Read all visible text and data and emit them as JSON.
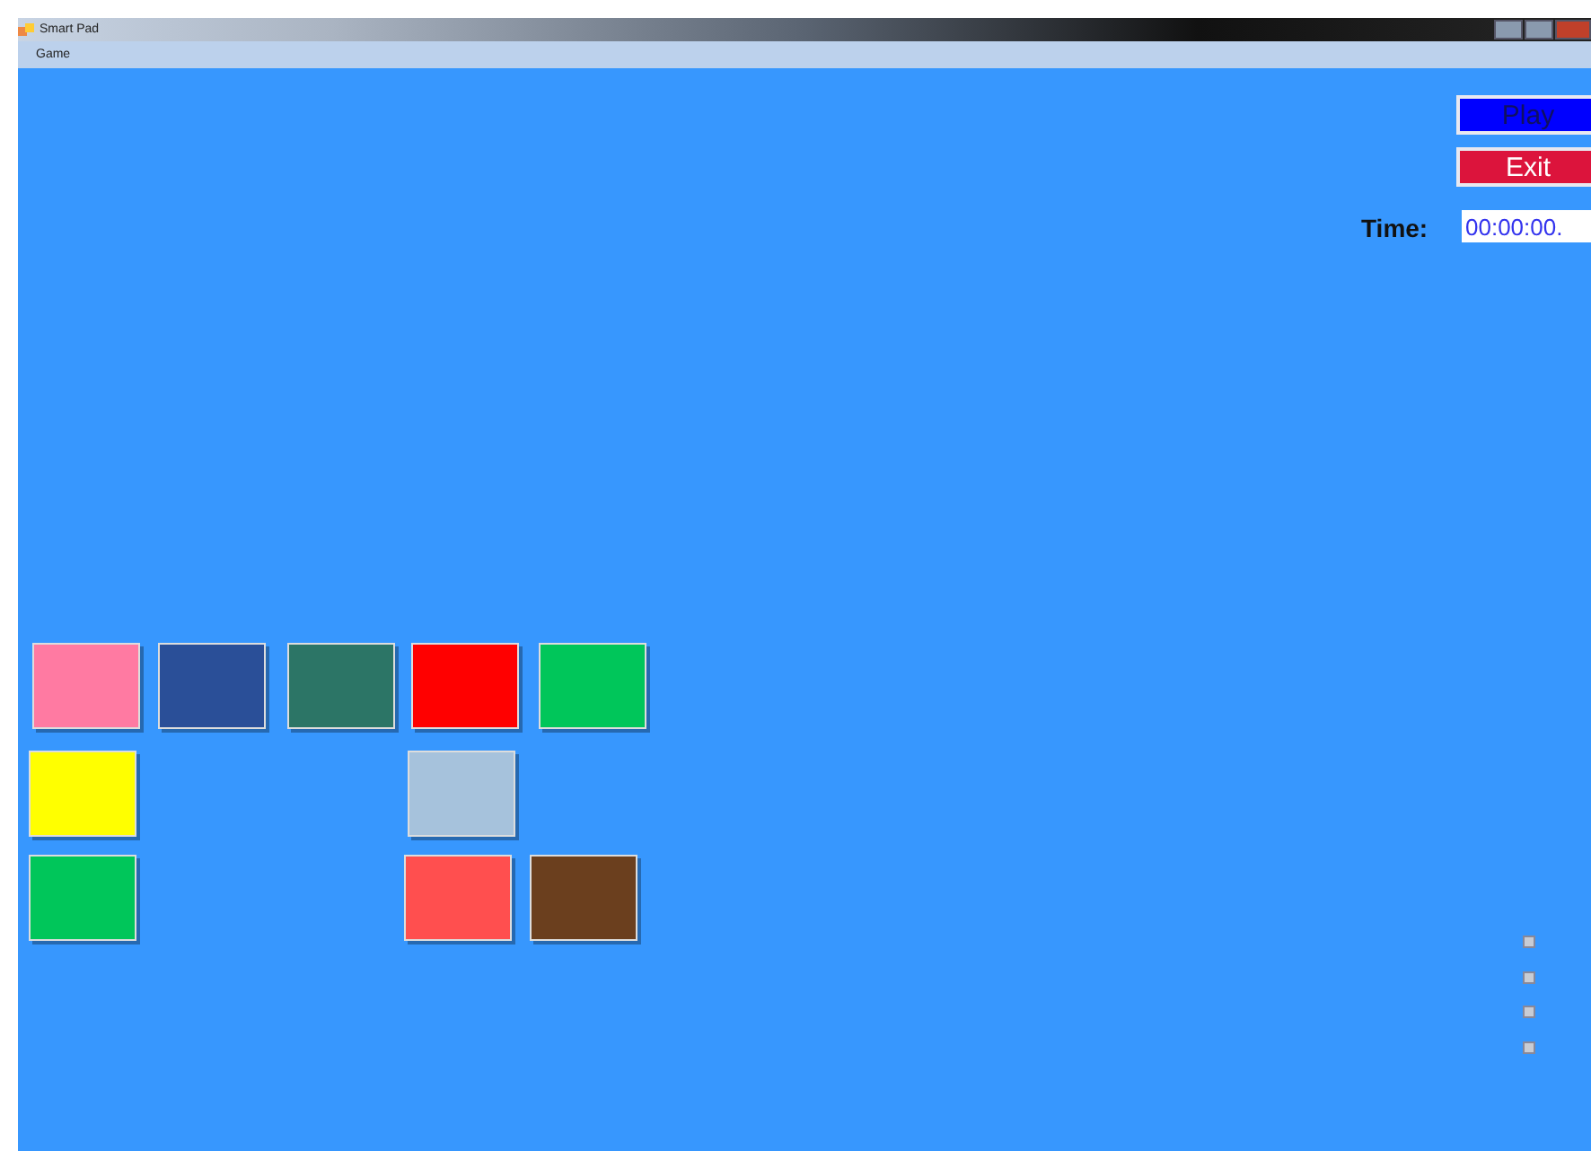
{
  "window": {
    "title": "Smart Pad"
  },
  "menu": [
    "Game"
  ],
  "buttons": [
    {
      "label": "Play",
      "color": "#0000ff"
    },
    {
      "label": "Exit",
      "color": "#dc143c"
    }
  ],
  "timer": {
    "label": "Time:",
    "value": "00:00:00."
  },
  "tiles": [
    {
      "color": "#ff7aa2"
    },
    {
      "color": "#2a4f98"
    },
    {
      "color": "#2c7566"
    },
    {
      "color": "#ff0000"
    },
    {
      "color": "#00c65a"
    },
    {
      "color": "#ffff00"
    },
    {
      "color": "#a6c2dc"
    },
    {
      "color": "#00c65a"
    },
    {
      "color": "#ff4f4f"
    },
    {
      "color": "#6b3f1e"
    }
  ]
}
